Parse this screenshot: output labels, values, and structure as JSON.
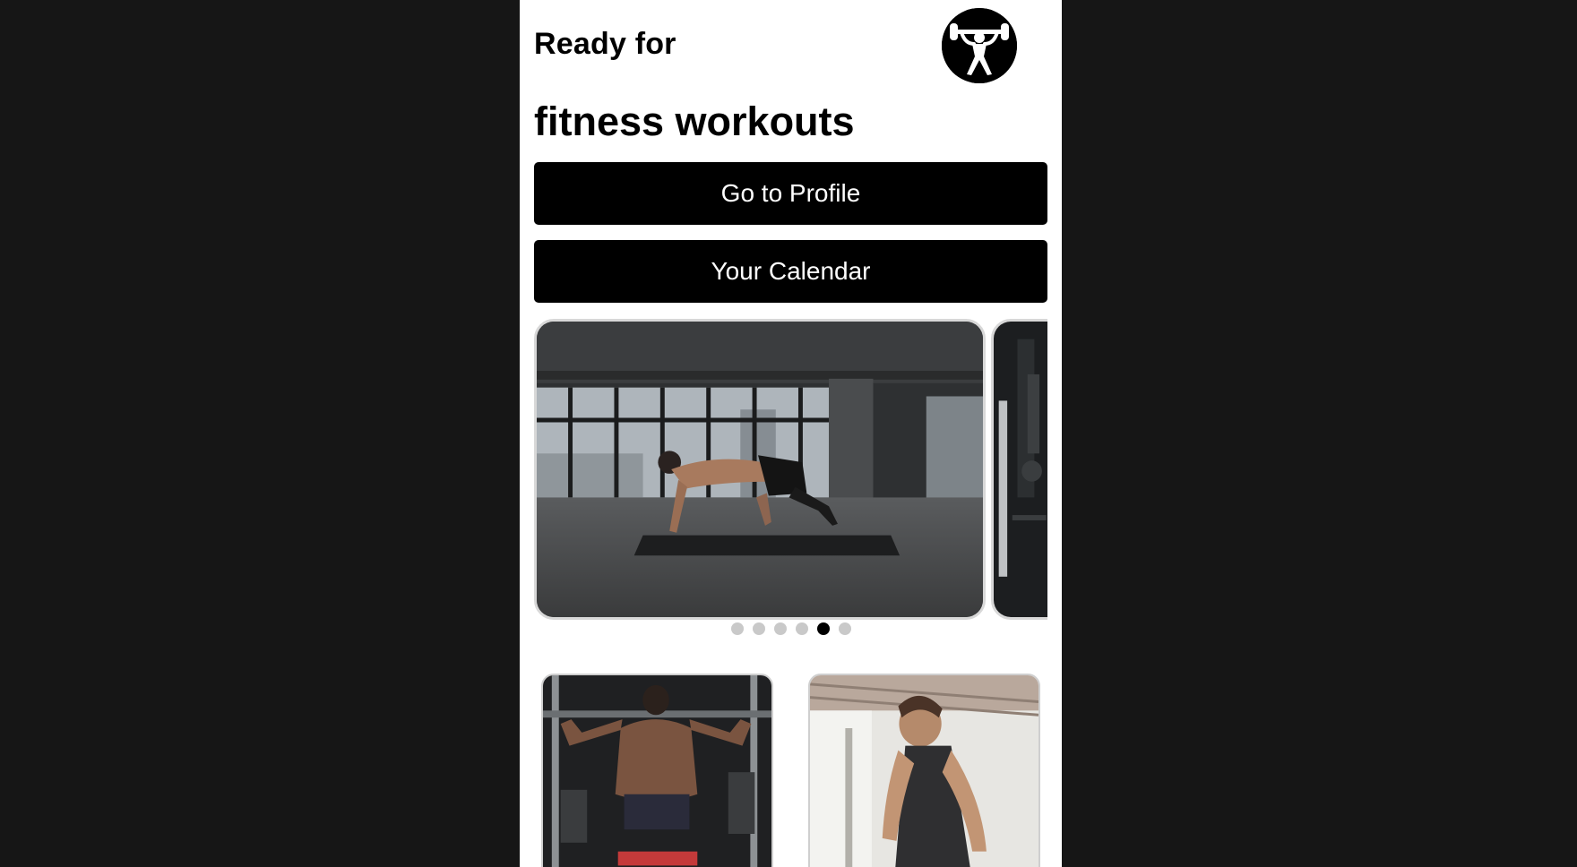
{
  "header": {
    "greeting": "Ready for",
    "headline": "fitness workouts",
    "logo_icon": "weightlifter-icon"
  },
  "actions": {
    "profile_label": "Go to Profile",
    "calendar_label": "Your Calendar"
  },
  "carousel": {
    "slides": [
      {
        "icon": "gym-photo"
      },
      {
        "icon": "gym-photo"
      },
      {
        "icon": "gym-photo"
      },
      {
        "icon": "gym-photo"
      },
      {
        "icon": "mountain-climber-photo"
      },
      {
        "icon": "gym-equipment-photo"
      }
    ],
    "active_index": 4,
    "dot_count": 6
  },
  "workout_cards": [
    {
      "icon": "back-workout-photo"
    },
    {
      "icon": "man-in-tank-top-photo"
    }
  ],
  "colors": {
    "background": "#161616",
    "surface": "#ffffff",
    "button": "#000000",
    "button_text": "#ffffff",
    "dot_inactive": "#c9c9c9",
    "dot_active": "#000000"
  }
}
